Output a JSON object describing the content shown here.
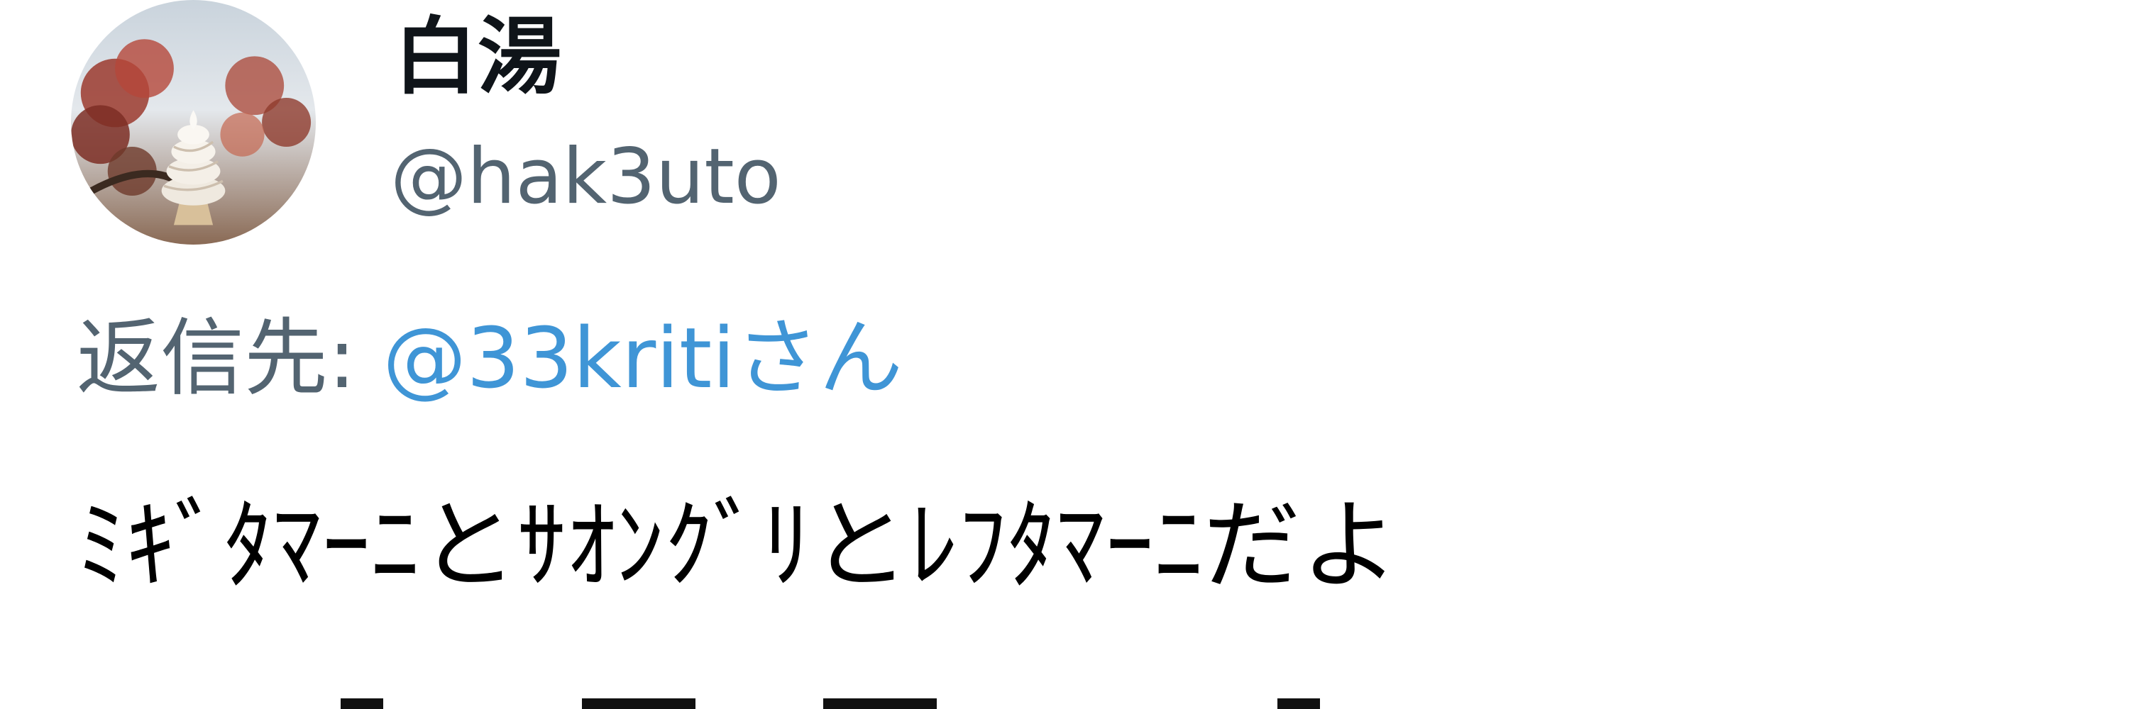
{
  "tweet": {
    "display_name": "白湯",
    "handle": "@hak3uto",
    "reply_prefix": "返信先: ",
    "reply_mention": "@33kritiさん",
    "text": "ﾐｷﾞﾀﾏｰﾆとｻｵﾝｸﾞﾘとﾚﾌﾀﾏｰﾆだよ"
  },
  "colors": {
    "name": "#0f1419",
    "secondary": "#536471",
    "mention": "#3f95d6",
    "body": "#000000"
  },
  "icons": {
    "avatar": "profile-photo-soft-serve-autumn-tree"
  }
}
